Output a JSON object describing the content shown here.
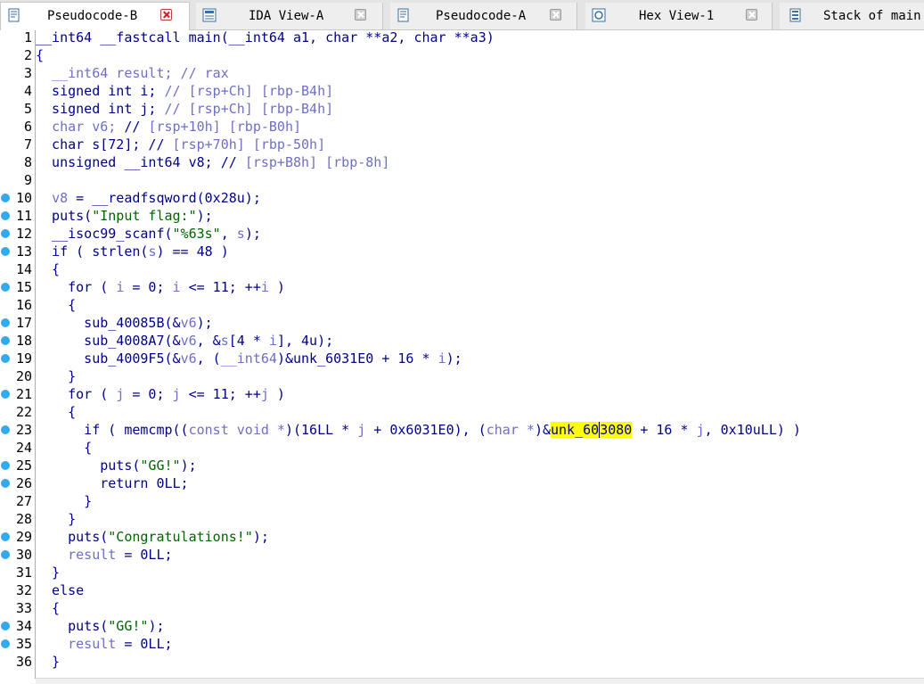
{
  "tabs": [
    {
      "label": "Pseudocode-B",
      "icon": "pseudocode-icon",
      "active": true
    },
    {
      "label": "IDA View-A",
      "icon": "ida-view-icon",
      "active": false
    },
    {
      "label": "Pseudocode-A",
      "icon": "pseudocode-icon",
      "active": false
    },
    {
      "label": "Hex View-1",
      "icon": "hex-view-icon",
      "active": false
    },
    {
      "label": "Stack of main",
      "icon": "stack-icon",
      "active": false
    }
  ],
  "colors": {
    "keyword": "#00008b",
    "variable": "#6f6fc7",
    "string": "#006400",
    "highlight": "#ffff00",
    "breakpoint_dot": "#33aaee"
  },
  "code": {
    "cursor_symbol": "unk_603080",
    "lines": [
      {
        "n": "1",
        "dot": false,
        "segs": [
          [
            "__int64 __fastcall main(__int64 a1, char **a2, char **a3)",
            ""
          ]
        ]
      },
      {
        "n": "2",
        "dot": false,
        "segs": [
          [
            "{",
            ""
          ]
        ]
      },
      {
        "n": "3",
        "dot": false,
        "segs": [
          [
            "  ",
            ""
          ],
          [
            "__int64 result; // rax",
            "typ"
          ]
        ]
      },
      {
        "n": "4",
        "dot": false,
        "segs": [
          [
            "  signed int i; ",
            ""
          ],
          [
            "// [rsp+Ch] [rbp-B4h]",
            "cmt"
          ]
        ]
      },
      {
        "n": "5",
        "dot": false,
        "segs": [
          [
            "  signed int j; ",
            ""
          ],
          [
            "// [rsp+Ch] [rbp-B4h]",
            "cmt"
          ]
        ]
      },
      {
        "n": "6",
        "dot": false,
        "segs": [
          [
            "  ",
            ""
          ],
          [
            "char v6;",
            "typ"
          ],
          [
            " // ",
            ""
          ],
          [
            "[rsp+10h] [rbp-B0h]",
            "cmt"
          ]
        ]
      },
      {
        "n": "7",
        "dot": false,
        "segs": [
          [
            "  char s[72]; // ",
            ""
          ],
          [
            "[rsp+70h] [rbp-50h]",
            "cmt"
          ]
        ]
      },
      {
        "n": "8",
        "dot": false,
        "segs": [
          [
            "  unsigned __int64 v8; // ",
            ""
          ],
          [
            "[rsp+B8h] [rbp-8h]",
            "cmt"
          ]
        ]
      },
      {
        "n": "9",
        "dot": false,
        "segs": [
          [
            "",
            ""
          ]
        ]
      },
      {
        "n": "10",
        "dot": true,
        "segs": [
          [
            "  ",
            ""
          ],
          [
            "v8",
            "var"
          ],
          [
            " = __readfsqword(0x28u);",
            ""
          ]
        ]
      },
      {
        "n": "11",
        "dot": true,
        "segs": [
          [
            "  puts(",
            ""
          ],
          [
            "\"Input flag:\"",
            "str"
          ],
          [
            ");",
            ""
          ]
        ]
      },
      {
        "n": "12",
        "dot": true,
        "segs": [
          [
            "  __isoc99_scanf(",
            ""
          ],
          [
            "\"%63s\"",
            "str"
          ],
          [
            ", ",
            ""
          ],
          [
            "s",
            "var"
          ],
          [
            ");",
            ""
          ]
        ]
      },
      {
        "n": "13",
        "dot": true,
        "segs": [
          [
            "  if ( strlen(",
            ""
          ],
          [
            "s",
            "var"
          ],
          [
            ") == 48 )",
            ""
          ]
        ]
      },
      {
        "n": "14",
        "dot": false,
        "segs": [
          [
            "  {",
            ""
          ]
        ]
      },
      {
        "n": "15",
        "dot": true,
        "segs": [
          [
            "    for ( ",
            ""
          ],
          [
            "i",
            "var"
          ],
          [
            " = 0; ",
            ""
          ],
          [
            "i",
            "var"
          ],
          [
            " <= 11; ++",
            ""
          ],
          [
            "i",
            "var"
          ],
          [
            " )",
            ""
          ]
        ]
      },
      {
        "n": "16",
        "dot": false,
        "segs": [
          [
            "    {",
            ""
          ]
        ]
      },
      {
        "n": "17",
        "dot": true,
        "segs": [
          [
            "      sub_40085B(&",
            ""
          ],
          [
            "v6",
            "var"
          ],
          [
            ");",
            ""
          ]
        ]
      },
      {
        "n": "18",
        "dot": true,
        "segs": [
          [
            "      sub_4008A7(&",
            ""
          ],
          [
            "v6",
            "var"
          ],
          [
            ", &",
            ""
          ],
          [
            "s",
            "var"
          ],
          [
            "[4 * ",
            ""
          ],
          [
            "i",
            "var"
          ],
          [
            "], 4u);",
            ""
          ]
        ]
      },
      {
        "n": "19",
        "dot": true,
        "segs": [
          [
            "      sub_4009F5(&",
            ""
          ],
          [
            "v6",
            "var"
          ],
          [
            ", (",
            ""
          ],
          [
            "__int64",
            "typ"
          ],
          [
            ")&unk_6031E0 + 16 * ",
            ""
          ],
          [
            "i",
            "var"
          ],
          [
            ");",
            ""
          ]
        ]
      },
      {
        "n": "20",
        "dot": false,
        "segs": [
          [
            "    }",
            ""
          ]
        ]
      },
      {
        "n": "21",
        "dot": true,
        "segs": [
          [
            "    for ( ",
            ""
          ],
          [
            "j",
            "var"
          ],
          [
            " = 0; ",
            ""
          ],
          [
            "j",
            "var"
          ],
          [
            " <= 11; ++",
            ""
          ],
          [
            "j",
            "var"
          ],
          [
            " )",
            ""
          ]
        ]
      },
      {
        "n": "22",
        "dot": false,
        "segs": [
          [
            "    {",
            ""
          ]
        ]
      },
      {
        "n": "23",
        "dot": true,
        "segs": [
          [
            "      if ( memcmp((",
            ""
          ],
          [
            "const void *",
            "typ"
          ],
          [
            ")(16LL * ",
            ""
          ],
          [
            "j",
            "var"
          ],
          [
            " + 0x6031E0), (",
            ""
          ],
          [
            "char *",
            "typ"
          ],
          [
            ")&",
            ""
          ],
          [
            "unk_60",
            "hl"
          ],
          [
            "CARET",
            "caret"
          ],
          [
            "3080",
            "hl"
          ],
          [
            " + 16 * ",
            ""
          ],
          [
            "j",
            "var"
          ],
          [
            ", 0x10uLL) )",
            ""
          ]
        ]
      },
      {
        "n": "24",
        "dot": false,
        "segs": [
          [
            "      {",
            ""
          ]
        ]
      },
      {
        "n": "25",
        "dot": true,
        "segs": [
          [
            "        puts(",
            ""
          ],
          [
            "\"GG!\"",
            "str"
          ],
          [
            ");",
            ""
          ]
        ]
      },
      {
        "n": "26",
        "dot": true,
        "segs": [
          [
            "        return 0LL;",
            ""
          ]
        ]
      },
      {
        "n": "27",
        "dot": false,
        "segs": [
          [
            "      }",
            ""
          ]
        ]
      },
      {
        "n": "28",
        "dot": false,
        "segs": [
          [
            "    }",
            ""
          ]
        ]
      },
      {
        "n": "29",
        "dot": true,
        "segs": [
          [
            "    puts(",
            ""
          ],
          [
            "\"Congratulations!\"",
            "str"
          ],
          [
            ");",
            ""
          ]
        ]
      },
      {
        "n": "30",
        "dot": true,
        "segs": [
          [
            "    ",
            ""
          ],
          [
            "result",
            "var"
          ],
          [
            " = 0LL;",
            ""
          ]
        ]
      },
      {
        "n": "31",
        "dot": false,
        "segs": [
          [
            "  }",
            ""
          ]
        ]
      },
      {
        "n": "32",
        "dot": false,
        "segs": [
          [
            "  else",
            ""
          ]
        ]
      },
      {
        "n": "33",
        "dot": false,
        "segs": [
          [
            "  {",
            ""
          ]
        ]
      },
      {
        "n": "34",
        "dot": true,
        "segs": [
          [
            "    puts(",
            ""
          ],
          [
            "\"GG!\"",
            "str"
          ],
          [
            ");",
            ""
          ]
        ]
      },
      {
        "n": "35",
        "dot": true,
        "segs": [
          [
            "    ",
            ""
          ],
          [
            "result",
            "var"
          ],
          [
            " = 0LL;",
            ""
          ]
        ]
      },
      {
        "n": "36",
        "dot": false,
        "segs": [
          [
            "  }",
            ""
          ]
        ]
      }
    ]
  }
}
